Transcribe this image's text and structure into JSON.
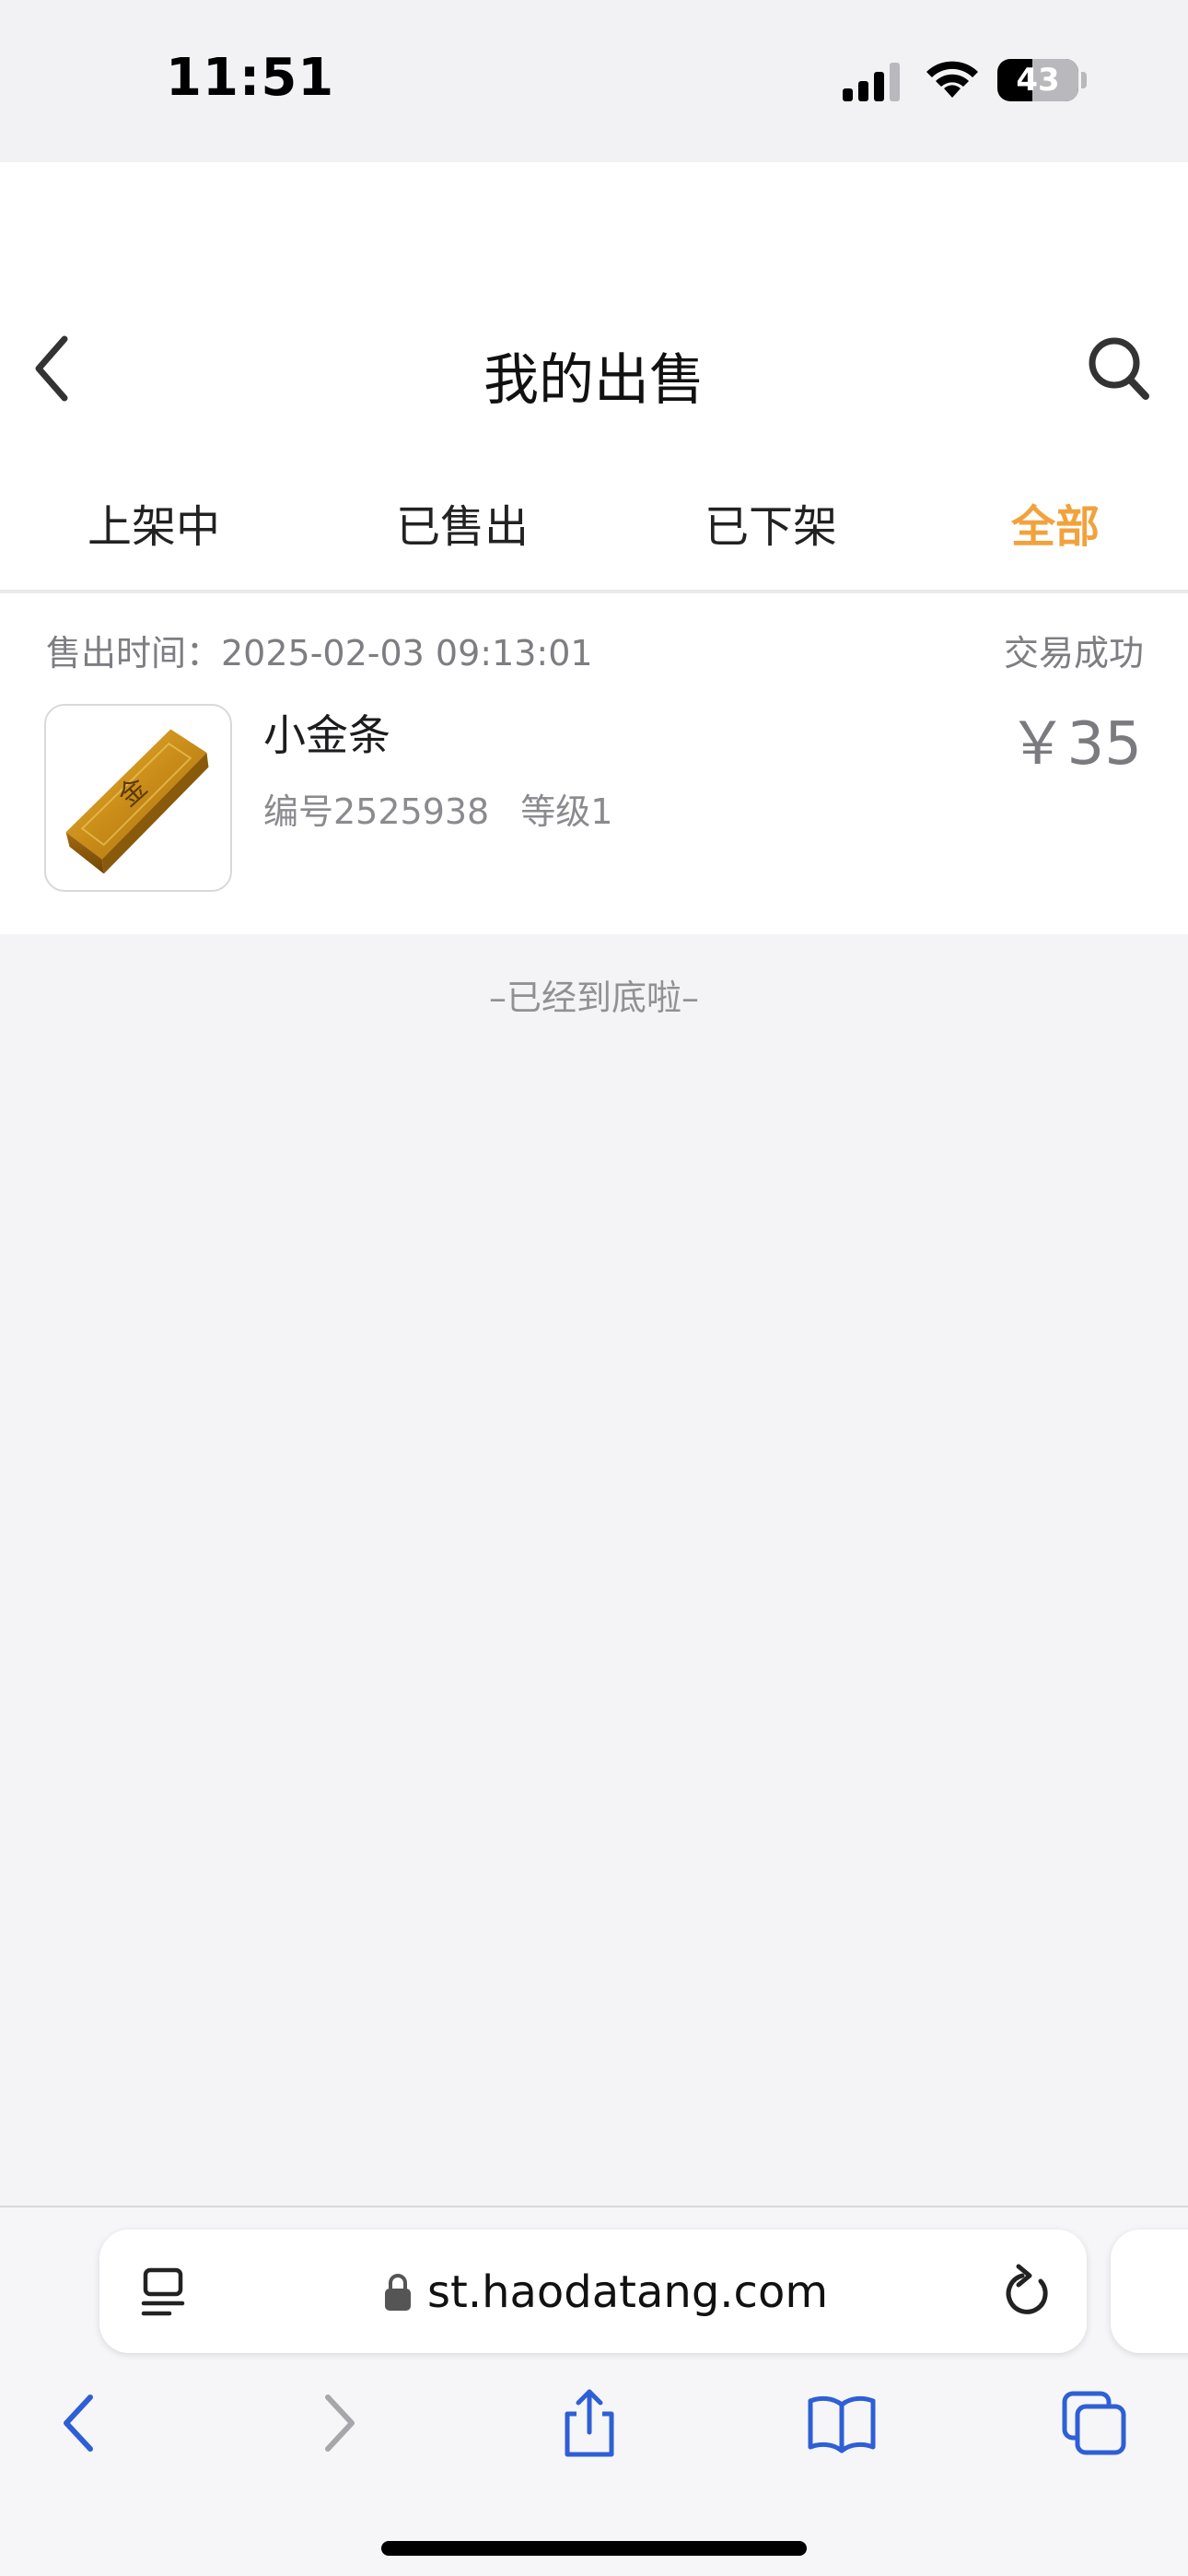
{
  "status_bar": {
    "time": "11:51",
    "battery": "43",
    "battery_level_percent": 43
  },
  "header": {
    "title": "我的出售",
    "back_icon": "chevron-left-icon",
    "search_icon": "search-icon"
  },
  "tabs": [
    {
      "label": "上架中",
      "active": false
    },
    {
      "label": "已售出",
      "active": false
    },
    {
      "label": "已下架",
      "active": false
    },
    {
      "label": "全部",
      "active": true
    }
  ],
  "colors": {
    "accent": "#f2a23c",
    "secondary_text": "#7d7d82",
    "browser_blue": "#2f5fd6"
  },
  "order": {
    "sold_time_label": "售出时间：2025-02-03 09:13:01",
    "status": "交易成功",
    "item_name": "小金条",
    "item_id": "编号2525938",
    "item_level": "等级1",
    "price": "￥35",
    "thumbnail_icon": "gold-bar-icon"
  },
  "end_note": "–已经到底啦–",
  "browser": {
    "url": "st.haodatang.com",
    "icons": [
      "reader-icon",
      "lock-icon",
      "reload-icon",
      "back-icon",
      "forward-icon",
      "share-icon",
      "bookmarks-icon",
      "tabs-icon"
    ]
  }
}
